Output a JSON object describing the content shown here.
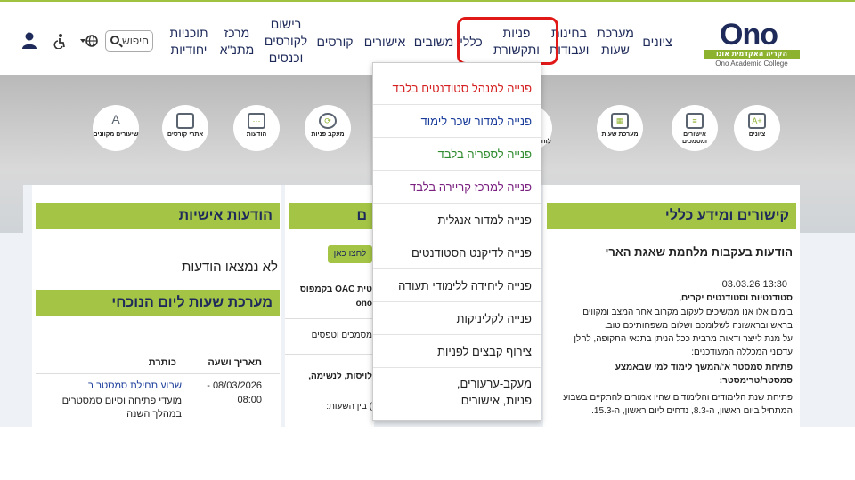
{
  "header": {
    "logo": {
      "brand": "Ono",
      "hebrew": "הקריה האקדמית אונו",
      "english": "Ono Academic College"
    },
    "nav": [
      "ציונים",
      "מערכת שעות",
      "בחינות ועבודות",
      "פניות ותקשורת",
      "כללי",
      "משובים",
      "אישורים",
      "קורסים",
      "רישום לקורסים וכנסים",
      "מרכז מתנ\"א",
      "תוכניות יחודיות"
    ],
    "search_placeholder": "חיפוש",
    "icons": [
      "user-icon",
      "accessibility-icon",
      "globe-icon"
    ]
  },
  "tiles": [
    {
      "label": "ציונים",
      "icon": "grades-icon"
    },
    {
      "label": "אישורים ומסמכים",
      "icon": "documents-icon"
    },
    {
      "label": "מערכת שעות",
      "icon": "calendar-icon"
    },
    {
      "label": "לוח בחינ",
      "icon": "exam-board-icon"
    },
    {
      "label": "מעקב פניות",
      "icon": "tracking-icon"
    },
    {
      "label": "הודעות",
      "icon": "messages-icon"
    },
    {
      "label": "אתרי קורסים",
      "icon": "folder-icon"
    },
    {
      "label": "שיעורים מקוונים",
      "icon": "online-lessons-icon"
    }
  ],
  "dropdown": {
    "items": [
      {
        "label": "פנייה למנהל סטודנטים בלבד",
        "color": "#d42020"
      },
      {
        "label": "פנייה למדור שכר לימוד",
        "color": "#1a3c9a"
      },
      {
        "label": "פנייה לספריה בלבד",
        "color": "#2e8b2e"
      },
      {
        "label": "פנייה למרכז קריירה בלבד",
        "color": "#7a2080"
      },
      {
        "label": "פנייה למדור אנגלית",
        "color": "#222222"
      },
      {
        "label": "פנייה לדיקנט הסטודנטים",
        "color": "#222222"
      },
      {
        "label": "פנייה ליחידה ללימודי תעודה",
        "color": "#222222"
      },
      {
        "label": "פנייה לקליניקות",
        "color": "#222222"
      },
      {
        "label": "צירוף קבצים לפניות",
        "color": "#222222"
      },
      {
        "label": "מעקב-ערעורים, פניות, אישורים",
        "color": "#222222"
      }
    ]
  },
  "panels": {
    "links": {
      "title": "קישורים ומידע כללי",
      "subtitle": "הודעות בעקבות מלחמת שאגת הארי",
      "timestamp": "13:30 03.03.26",
      "greeting": "סטודנטיות וסטודנטים יקרים,",
      "body": [
        "בימים אלו אנו ממשיכים לעקוב מקרוב אחר המצב ומקווים",
        "בראש ובראשונה לשלומכם ושלום משפחותיכם טוב.",
        "על מנת לייצר ודאות מרבית ככל הניתן בתנאי התקופה, להלן",
        "עדכוני המכללה המעודכנים:"
      ],
      "bold_line": "פתיחת סמסטר א'/המשך לימוד למי שבאמצע סמסטר/טרימסטר:",
      "body2": "פתיחת שנת הלימודים והלימודים שהיו אמורים להתקיים בשבוע המתחיל ביום ראשון, ה-8.3, נדחים ליום ראשון, ה-15.3."
    },
    "middle": {
      "title": "ם",
      "button": "לחצו כאן",
      "line1": "טית OAC בקמפוס",
      "line2": "ono",
      "line3": "מסמכים וטפסים",
      "line4": "לויסות, לנשימה,",
      "line5": ") בין השעות:"
    },
    "personal": {
      "title": "הודעות אישיות",
      "empty": "לא נמצאו הודעות",
      "schedule_title": "מערכת שעות ליום הנוכחי",
      "columns": [
        "כותרת",
        "תאריך ושעה"
      ],
      "row": {
        "title": "שבוע תחילת סמסטר ב",
        "desc": "מועדי פתיחה וסיום סמסטרים במהלך השנה",
        "date": "08/03/2026 -",
        "time": "08:00"
      }
    }
  }
}
